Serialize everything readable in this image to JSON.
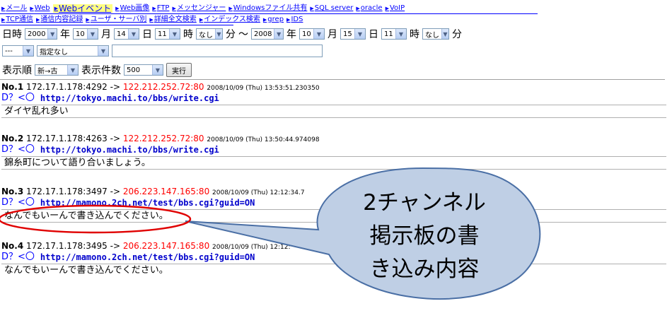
{
  "nav": {
    "row1": [
      {
        "label": "メール",
        "active": false
      },
      {
        "label": "Web",
        "active": false
      },
      {
        "label": "Webイベント",
        "active": true
      },
      {
        "label": "Web画像",
        "active": false
      },
      {
        "label": "FTP",
        "active": false
      },
      {
        "label": "メッセンジャー",
        "active": false
      },
      {
        "label": "Windowsファイル共有",
        "active": false
      },
      {
        "label": "SQL server",
        "active": false
      },
      {
        "label": "oracle",
        "active": false
      },
      {
        "label": "VoIP",
        "active": false
      }
    ],
    "row2": [
      {
        "label": "TCP通信"
      },
      {
        "label": "通信内容記録"
      },
      {
        "label": "ユーザ・サーバ別"
      },
      {
        "label": "詳細全文検索"
      },
      {
        "label": "インデックス検索"
      },
      {
        "label": "grep"
      },
      {
        "label": "IDS"
      }
    ]
  },
  "filter": {
    "from": {
      "year": "2000",
      "month": "10",
      "day": "14",
      "hour": "11",
      "minute": "なし"
    },
    "to": {
      "year": "2008",
      "month": "10",
      "day": "15",
      "hour": "11",
      "minute": "なし"
    },
    "labels": {
      "datetime": "日時",
      "year": "年",
      "month": "月",
      "day": "日",
      "hour": "時",
      "minute": "分",
      "tilde": "〜"
    },
    "select_a": "---",
    "select_b": "指定なし",
    "text_value": "",
    "order_label": "表示順",
    "order_value": "新→古",
    "count_label": "表示件数",
    "count_value": "500",
    "run_label": "実行"
  },
  "entries": [
    {
      "no": "No.1",
      "src": "172.17.1.178:4292",
      "arrow": "->",
      "dst": "122.212.252.72:80",
      "ts": "2008/10/09 (Thu) 13:53:51.230350",
      "proto": "D？<〇",
      "url": "http://tokyo.machi.to/bbs/write.cgi",
      "msg": "ダイヤ乱れ多い"
    },
    {
      "no": "No.2",
      "src": "172.17.1.178:4263",
      "arrow": "->",
      "dst": "122.212.252.72:80",
      "ts": "2008/10/09 (Thu) 13:50:44.974098",
      "proto": "D？<〇",
      "url": "http://tokyo.machi.to/bbs/write.cgi",
      "msg": "錦糸町について語り合いましょう。"
    },
    {
      "no": "No.3",
      "src": "172.17.1.178:3497",
      "arrow": "->",
      "dst": "206.223.147.165:80",
      "ts": "2008/10/09 (Thu) 12:12:34.7",
      "proto": "D？<〇",
      "url": "http://mamono.2ch.net/test/bbs.cgi?guid=ON",
      "msg": "なんでもいーんで書き込んでください。"
    },
    {
      "no": "No.4",
      "src": "172.17.1.178:3495",
      "arrow": "->",
      "dst": "206.223.147.165:80",
      "ts": "2008/10/09 (Thu) 12:12:",
      "proto": "D？<〇",
      "url": "http://mamono.2ch.net/test/bbs.cgi?guid=ON",
      "msg": "なんでもいーんで書き込んでください。"
    }
  ],
  "callout": {
    "lines": [
      "2チャンネル",
      "掲示板の書",
      "き込み内容"
    ],
    "fill": "#bfcfe5",
    "stroke": "#4a6fa5",
    "ellipse_color": "#e00000"
  }
}
